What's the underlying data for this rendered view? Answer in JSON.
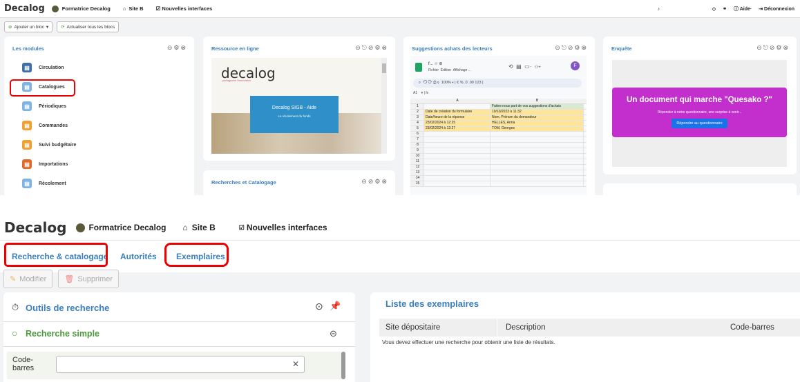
{
  "top": {
    "header": {
      "logo": "Decalog",
      "user": "Formatrice Decalog",
      "site": "Site B",
      "new_ui": "Nouvelles interfaces",
      "aide": "Aide·",
      "logout": "Déconnexion"
    },
    "toolbar": {
      "add_block": "Ajouter un bloc",
      "refresh_all": "Actualiser tous les blocs"
    },
    "modules": {
      "title": "Les modules",
      "items": [
        {
          "label": "Circulation",
          "color": "#3f6fa8"
        },
        {
          "label": "Catalogues",
          "color": "#7fb3e3"
        },
        {
          "label": "Périodiques",
          "color": "#7fb3e3"
        },
        {
          "label": "Commandes",
          "color": "#f0a030"
        },
        {
          "label": "Suivi budgétaire",
          "color": "#f0a030"
        },
        {
          "label": "Importations",
          "color": "#e06a2a"
        },
        {
          "label": "Récolement",
          "color": "#7fb3e3"
        }
      ]
    },
    "resource": {
      "title": "Ressource en ligne",
      "logo_text": "decalog",
      "tagline": "partageons l'innovation",
      "box_title": "Decalog SIGB - Aide",
      "box_sub": "Le récolement du fonds"
    },
    "searches": {
      "title": "Recherches et Catalogage"
    },
    "suggestions": {
      "title": "Suggestions achats des lecteurs",
      "file": "f...",
      "menu1": "Fichier",
      "menu2": "Édition",
      "menu3": "Affichage ...",
      "zoom": "100%",
      "avatar": "F",
      "cell": "A1",
      "col_a": "A",
      "col_b": "B",
      "rows": [
        [
          "1",
          "",
          "Faites-nous part de vos suggestions d'achats"
        ],
        [
          "2",
          "Date de création du formulaire",
          "19/10/2023 à 11:32"
        ],
        [
          "3",
          "Date/heure de la réponse",
          "Nom, Prénom du demandeur"
        ],
        [
          "4",
          "23/02/2024 à 12:25",
          "HELLES, Anna"
        ],
        [
          "5",
          "23/02/2024 à 12:27",
          "TOM, Georges"
        ],
        [
          "6",
          "",
          ""
        ],
        [
          "7",
          "",
          ""
        ],
        [
          "8",
          "",
          ""
        ],
        [
          "9",
          "",
          ""
        ],
        [
          "10",
          "",
          ""
        ],
        [
          "11",
          "",
          ""
        ],
        [
          "12",
          "",
          ""
        ],
        [
          "13",
          "",
          ""
        ],
        [
          "14",
          "",
          ""
        ],
        [
          "15",
          "",
          ""
        ]
      ]
    },
    "survey": {
      "title": "Enquête",
      "headline": "Un document qui marche \"Quesako ?\"",
      "sub": "Répondez à notre questionnaire, une surprise à venir...",
      "button": "Répondre au questionnaire"
    }
  },
  "bottom": {
    "header": {
      "logo": "Decalog",
      "user": "Formatrice Decalog",
      "site": "Site B",
      "new_ui": "Nouvelles interfaces"
    },
    "tabs": [
      "Recherche & catalogage",
      "Autorités",
      "Exemplaires"
    ],
    "toolbar": {
      "edit": "Modifier",
      "delete": "Supprimer"
    },
    "search_tools": {
      "title": "Outils de recherche",
      "simple": "Recherche simple",
      "field_label": "Code-\nbarres",
      "field_value": ""
    },
    "list": {
      "title": "Liste des exemplaires",
      "columns": [
        "Site dépositaire",
        "Description",
        "Code-barres"
      ],
      "empty": "Vous devez effectuer une recherche pour obtenir une liste de résultats."
    }
  }
}
